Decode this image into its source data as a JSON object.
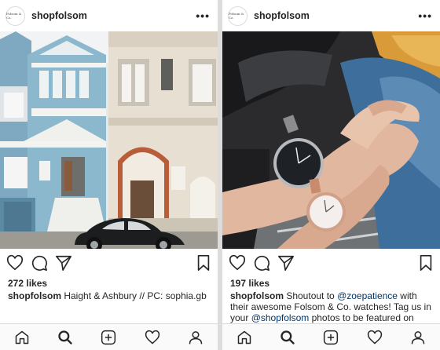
{
  "posts": [
    {
      "avatar_text": "Folsom & Co.",
      "username": "shopfolsom",
      "more": "•••",
      "likes": "272 likes",
      "caption_user": "shopfolsom",
      "caption_text": " Haight & Ashbury // PC: sophia.gb",
      "photo_subject": "Victorian houses with vintage car"
    },
    {
      "avatar_text": "Folsom & Co.",
      "username": "shopfolsom",
      "more": "•••",
      "likes": "197 likes",
      "caption_user": "shopfolsom",
      "caption_part1": " Shoutout to ",
      "mention1": "@zoepatience",
      "caption_part2": " with their awesome Folsom & Co. watches! Tag us in your ",
      "mention2": "@shopfolsom",
      "caption_part3": " photos to be featured on",
      "photo_subject": "Two hands wearing watches"
    }
  ],
  "icons": {
    "like": "heart-icon",
    "comment": "comment-icon",
    "share": "share-icon",
    "save": "bookmark-icon",
    "nav": [
      "home-icon",
      "search-icon",
      "add-post-icon",
      "activity-heart-icon",
      "profile-icon"
    ]
  },
  "colors": {
    "text": "#262626",
    "mention": "#003569",
    "border": "#dbdbdb",
    "nav_bg": "#fafafa"
  }
}
